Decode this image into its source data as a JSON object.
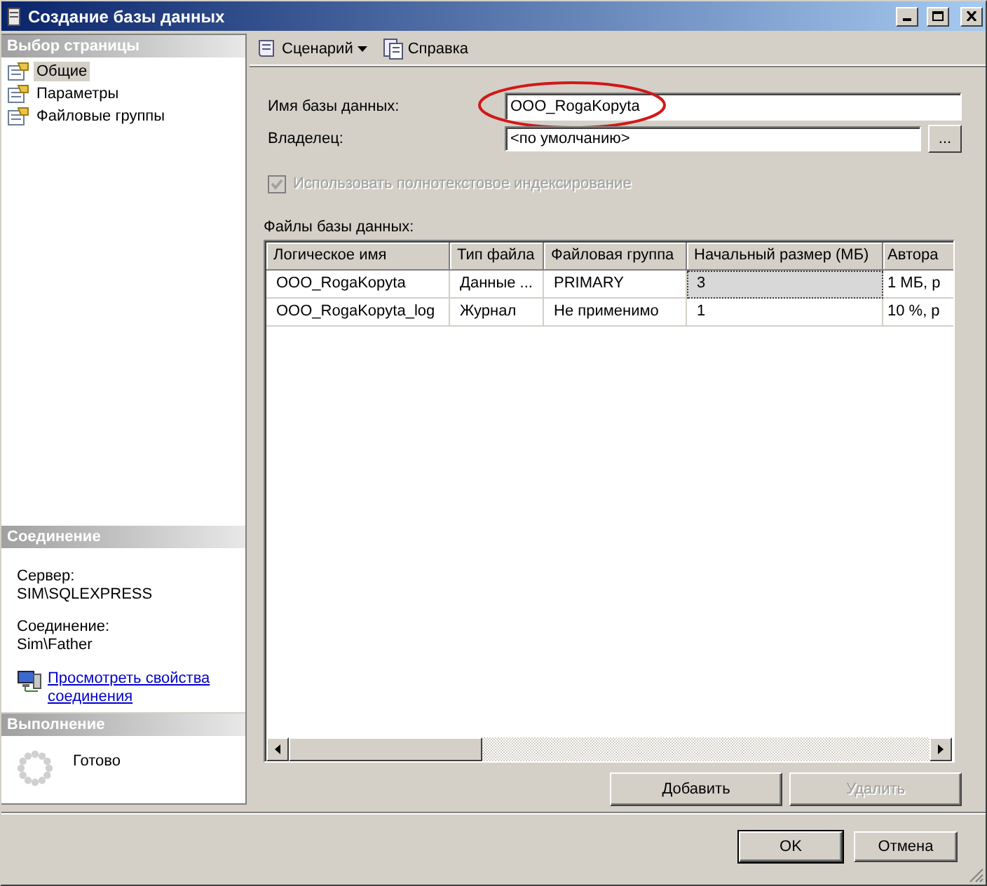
{
  "window": {
    "title": "Создание базы данных"
  },
  "sidebar": {
    "header": "Выбор страницы",
    "items": [
      {
        "label": "Общие",
        "selected": true
      },
      {
        "label": "Параметры",
        "selected": false
      },
      {
        "label": "Файловые группы",
        "selected": false
      }
    ]
  },
  "connection": {
    "header": "Соединение",
    "server_label": "Сервер:",
    "server": "SIM\\SQLEXPRESS",
    "connection_label": "Соединение:",
    "connection": "Sim\\Father",
    "link": "Просмотреть свойства соединения"
  },
  "progress": {
    "header": "Выполнение",
    "status": "Готово"
  },
  "toolbar": [
    {
      "label": "Сценарий",
      "kind": "dropdown"
    },
    {
      "label": "Справка",
      "kind": "help"
    }
  ],
  "form": {
    "name_label": "Имя базы данных:",
    "name_value": "OOO_RogaKopyta",
    "name_highlighted": true,
    "owner_label": "Владелец:",
    "owner_value": "<по умолчанию>",
    "browse": "...",
    "fulltext": {
      "label": "Использовать полнотекстовое индексирование",
      "checked": true,
      "disabled": true
    }
  },
  "files": {
    "label": "Файлы базы данных:",
    "columns": [
      "Логическое имя",
      "Тип файла",
      "Файловая группа",
      "Начальный размер (МБ)",
      "Автора"
    ],
    "rows": [
      {
        "cells": [
          {
            "text": "OOO_RogaKopyta",
            "selected": false
          },
          {
            "text": "Данные ...",
            "selected": false
          },
          {
            "text": "PRIMARY",
            "selected": false
          },
          {
            "text": "3",
            "selected": true
          },
          {
            "text": "1 МБ, р",
            "selected": false
          }
        ]
      },
      {
        "cells": [
          {
            "text": "OOO_RogaKopyta_log",
            "selected": false
          },
          {
            "text": "Журнал",
            "selected": false
          },
          {
            "text": "Не применимо",
            "selected": false
          },
          {
            "text": "1",
            "selected": false
          },
          {
            "text": "10 %, р",
            "selected": false
          }
        ]
      }
    ]
  },
  "grid_buttons": [
    {
      "label": "Добавить",
      "disabled": false
    },
    {
      "label": "Удалить",
      "disabled": true
    }
  ],
  "footer_buttons": [
    {
      "label": "OK",
      "default": true
    },
    {
      "label": "Отмена",
      "default": false
    }
  ]
}
